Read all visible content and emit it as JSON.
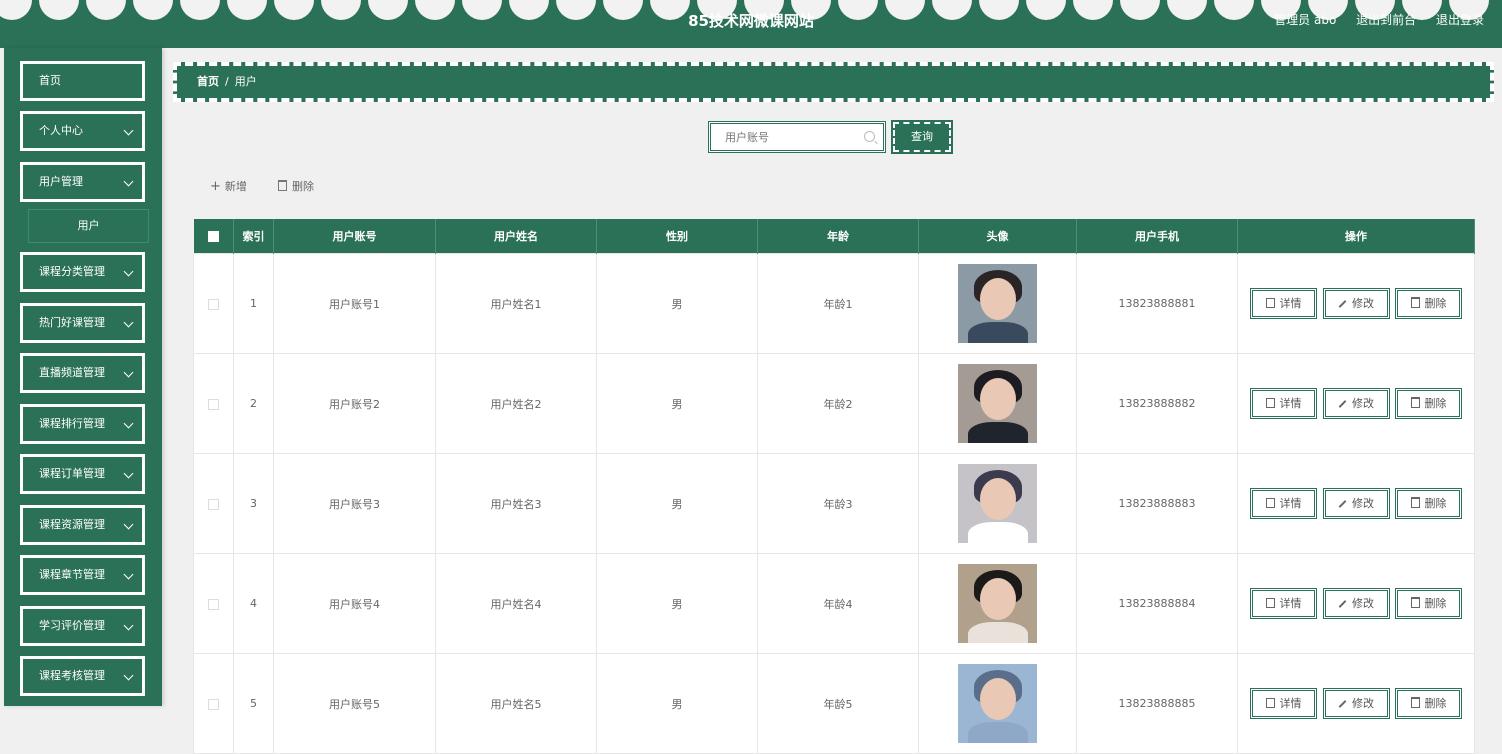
{
  "header": {
    "site_title": "85技术网微课网站",
    "user_label": "管理员 abo",
    "front_link": "退出到前台",
    "logout_link": "退出登录"
  },
  "sidebar": {
    "items": [
      {
        "label": "首页",
        "chevron": false
      },
      {
        "label": "个人中心",
        "chevron": true
      },
      {
        "label": "用户管理",
        "chevron": true
      },
      {
        "label": "课程分类管理",
        "chevron": true
      },
      {
        "label": "热门好课管理",
        "chevron": true
      },
      {
        "label": "直播频道管理",
        "chevron": true
      },
      {
        "label": "课程排行管理",
        "chevron": true
      },
      {
        "label": "课程订单管理",
        "chevron": true
      },
      {
        "label": "课程资源管理",
        "chevron": true
      },
      {
        "label": "课程章节管理",
        "chevron": true
      },
      {
        "label": "学习评价管理",
        "chevron": true
      },
      {
        "label": "课程考核管理",
        "chevron": true
      }
    ],
    "submenu_label": "用户"
  },
  "breadcrumb": {
    "home": "首页",
    "separator": "/",
    "current": "用户"
  },
  "search": {
    "placeholder": "用户账号",
    "button_label": "查询"
  },
  "actions": {
    "add_label": "新增",
    "delete_label": "删除"
  },
  "table": {
    "headers": {
      "index": "索引",
      "account": "用户账号",
      "name": "用户姓名",
      "gender": "性别",
      "age": "年龄",
      "avatar": "头像",
      "phone": "用户手机",
      "ops": "操作"
    },
    "rows": [
      {
        "index": "1",
        "account": "用户账号1",
        "name": "用户姓名1",
        "gender": "男",
        "age": "年龄1",
        "phone": "13823888881"
      },
      {
        "index": "2",
        "account": "用户账号2",
        "name": "用户姓名2",
        "gender": "男",
        "age": "年龄2",
        "phone": "13823888882"
      },
      {
        "index": "3",
        "account": "用户账号3",
        "name": "用户姓名3",
        "gender": "男",
        "age": "年龄3",
        "phone": "13823888883"
      },
      {
        "index": "4",
        "account": "用户账号4",
        "name": "用户姓名4",
        "gender": "男",
        "age": "年龄4",
        "phone": "13823888884"
      },
      {
        "index": "5",
        "account": "用户账号5",
        "name": "用户姓名5",
        "gender": "男",
        "age": "年龄5",
        "phone": "13823888885"
      }
    ],
    "row_buttons": {
      "detail": "详情",
      "edit": "修改",
      "delete": "删除"
    }
  },
  "colors": {
    "primary": "#2b7158",
    "background": "#f0f0f0"
  }
}
